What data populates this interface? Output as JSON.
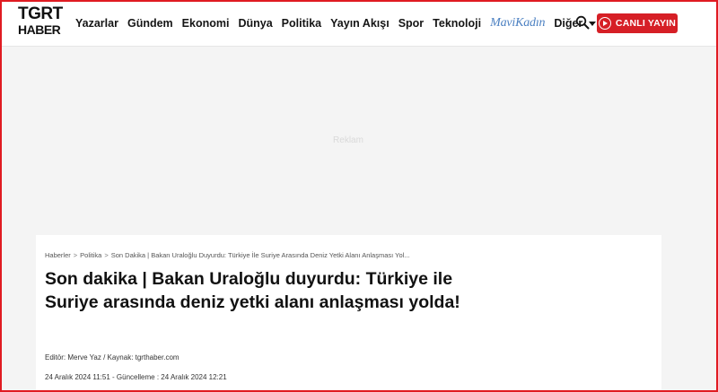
{
  "header": {
    "logo_line1": "TGRT",
    "logo_line2": "HABER",
    "nav": [
      "Yazarlar",
      "Gündem",
      "Ekonomi",
      "Dünya",
      "Politika",
      "Yayın Akışı",
      "Spor",
      "Teknoloji"
    ],
    "mavi_kadin": "MaviKadın",
    "more_label": "Diğer",
    "live_label": "CANLI YAYIN"
  },
  "ad": {
    "label": "Reklam"
  },
  "article": {
    "breadcrumb": [
      "Haberler",
      "Politika",
      "Son Dakika | Bakan Uraloğlu Duyurdu: Türkiye İle Suriye Arasında Deniz Yetki Alanı Anlaşması Yol..."
    ],
    "title": "Son dakika | Bakan Uraloğlu duyurdu: Türkiye ile Suriye arasında deniz yetki alanı anlaşması yolda!",
    "editor_line": "Editör: Merve Yaz / Kaynak: tgrthaber.com",
    "dates_line": "24 Aralık 2024 11:51 - Güncelleme : 24 Aralık 2024 12:21"
  },
  "colors": {
    "brand_red": "#d61f26",
    "mavi_blue": "#4a7fc1"
  },
  "icons": [
    "search-icon",
    "live-play-icon",
    "chevron-down-icon"
  ]
}
